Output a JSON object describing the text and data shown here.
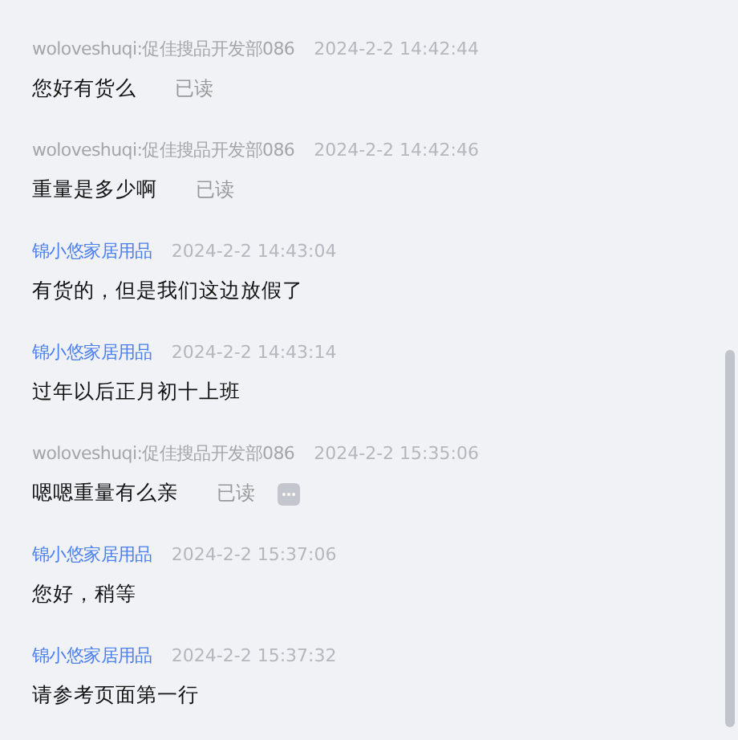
{
  "messages": [
    {
      "kind": "customer",
      "sender": "woloveshuqi:促佳搜品开发部086",
      "time": "2024-2-2 14:42:44",
      "text": "您好有货么",
      "read_label": "已读",
      "more": false
    },
    {
      "kind": "customer",
      "sender": "woloveshuqi:促佳搜品开发部086",
      "time": "2024-2-2 14:42:46",
      "text": "重量是多少啊",
      "read_label": "已读",
      "more": false
    },
    {
      "kind": "shop",
      "sender": "锦小悠家居用品",
      "time": "2024-2-2 14:43:04",
      "text": "有货的，但是我们这边放假了",
      "more": false
    },
    {
      "kind": "shop",
      "sender": "锦小悠家居用品",
      "time": "2024-2-2 14:43:14",
      "text": "过年以后正月初十上班",
      "more": false
    },
    {
      "kind": "customer",
      "sender": "woloveshuqi:促佳搜品开发部086",
      "time": "2024-2-2 15:35:06",
      "text": "嗯嗯重量有么亲",
      "read_label": "已读",
      "more": true
    },
    {
      "kind": "shop",
      "sender": "锦小悠家居用品",
      "time": "2024-2-2 15:37:06",
      "text": "您好，稍等",
      "more": false
    },
    {
      "kind": "shop",
      "sender": "锦小悠家居用品",
      "time": "2024-2-2 15:37:32",
      "text": "请参考页面第一行",
      "more": false
    }
  ]
}
